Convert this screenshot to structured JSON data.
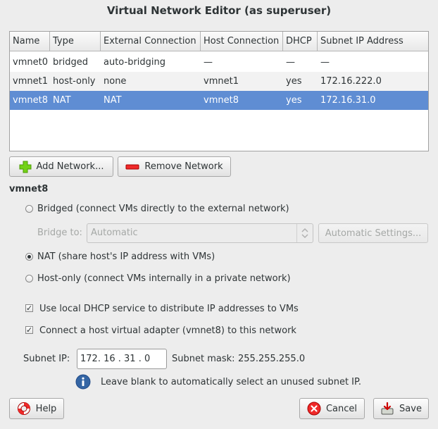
{
  "title": "Virtual Network Editor (as superuser)",
  "table": {
    "columns": [
      "Name",
      "Type",
      "External Connection",
      "Host Connection",
      "DHCP",
      "Subnet IP Address"
    ],
    "rows": [
      [
        "vmnet0",
        "bridged",
        "auto-bridging",
        "—",
        "—",
        "—"
      ],
      [
        "vmnet1",
        "host-only",
        "none",
        "vmnet1",
        "yes",
        "172.16.222.0"
      ],
      [
        "vmnet8",
        "NAT",
        "NAT",
        "vmnet8",
        "yes",
        "172.16.31.0"
      ]
    ],
    "selected_row": 2
  },
  "buttons": {
    "add_network": "Add Network...",
    "remove_network": "Remove Network",
    "automatic_settings": "Automatic Settings...",
    "help": "Help",
    "cancel": "Cancel",
    "save": "Save"
  },
  "section": {
    "title": "vmnet8"
  },
  "options": {
    "bridged": "Bridged (connect VMs directly to the external network)",
    "bridge_to_label": "Bridge to:",
    "bridge_to_value": "Automatic",
    "nat": "NAT (share host's IP address with VMs)",
    "host_only": "Host-only (connect VMs internally in a private network)",
    "selected": "nat"
  },
  "checkboxes": {
    "dhcp": "Use local DHCP service to distribute IP addresses to VMs",
    "dhcp_checked": true,
    "adapter": "Connect a host virtual adapter (vmnet8) to this network",
    "adapter_checked": true
  },
  "subnet": {
    "ip_label": "Subnet IP:",
    "ip_value": "172. 16 . 31 .  0",
    "mask_label": "Subnet mask:",
    "mask_value": "255.255.255.0",
    "hint": "Leave blank to automatically select an unused subnet IP."
  },
  "icons": {
    "add": "plus-icon",
    "remove": "minus-icon",
    "info": "info-icon",
    "help": "lifebuoy-icon",
    "cancel": "cancel-icon",
    "save": "save-icon"
  },
  "colors": {
    "selection": "#5f8dd3",
    "add_green": "#4e9a06",
    "remove_red": "#cc0000",
    "info_blue": "#3465a4"
  }
}
